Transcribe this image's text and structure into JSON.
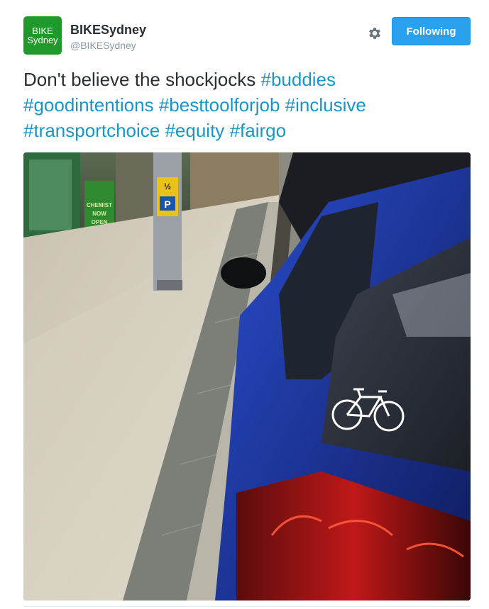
{
  "tweet": {
    "avatar_line1": "BIKE",
    "avatar_line2": "Sydney",
    "display_name": "BIKESydney",
    "handle": "@BIKESydney",
    "follow_label": "Following",
    "text_lead": "Don't believe the shockjocks ",
    "hashtags": [
      "#buddies",
      "#goodintentions",
      "#besttoolforjob",
      "#inclusive",
      "#transportchoice",
      "#equity",
      "#fairgo"
    ]
  },
  "photo": {
    "shop_sign_line1": "CHEMIST",
    "shop_sign_line2": "NOW",
    "shop_sign_line3": "OPEN",
    "meter_half": "½",
    "meter_p": "P"
  },
  "icons": {
    "settings": "gear-icon",
    "bicycle_sticker": "bicycle-icon"
  },
  "colors": {
    "follow_button": "#2aa1ef",
    "hashtag": "#1b95c7",
    "avatar_bg": "#1f9a2a",
    "car_body": "#1e3fb5"
  }
}
